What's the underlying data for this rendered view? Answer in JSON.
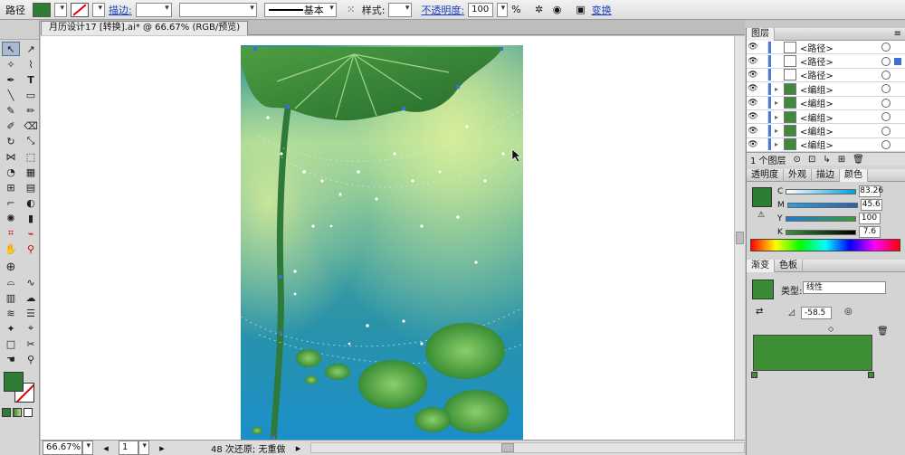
{
  "control_bar": {
    "object_type": "路径",
    "stroke_label": "描边:",
    "stroke_style": "基本",
    "style_label": "样式:",
    "opacity_label": "不透明度:",
    "opacity_value": "100",
    "opacity_unit": "%",
    "transform_label": "变换",
    "fill_color": "#2f7d34"
  },
  "document": {
    "tab_title": "月历设计17 [转换].ai* @ 66.67% (RGB/预览)"
  },
  "status_bar": {
    "zoom": "66.67%",
    "artboard": "1",
    "info": "48 次还原; 无重做"
  },
  "layers_panel": {
    "title": "图层",
    "rows": [
      {
        "name": "<路径>",
        "type": "path"
      },
      {
        "name": "<路径>",
        "type": "path"
      },
      {
        "name": "<路径>",
        "type": "path"
      },
      {
        "name": "<编组>",
        "type": "group"
      },
      {
        "name": "<编组>",
        "type": "group"
      },
      {
        "name": "<编组>",
        "type": "group"
      },
      {
        "name": "<编组>",
        "type": "group"
      },
      {
        "name": "<编组>",
        "type": "group"
      }
    ],
    "footer": "1 个图层"
  },
  "color_panel": {
    "tabs": [
      "透明度",
      "外观",
      "描边",
      "颜色"
    ],
    "channels": [
      {
        "name": "C",
        "value": "83.26"
      },
      {
        "name": "M",
        "value": "45.6"
      },
      {
        "name": "Y",
        "value": "100"
      },
      {
        "name": "K",
        "value": "7.6"
      }
    ],
    "swatch": "#2f7d34"
  },
  "gradient_panel": {
    "tabs": [
      "渐变",
      "色板"
    ],
    "type_label": "类型:",
    "type_value": "线性",
    "angle": "-58.5",
    "ramp_color": "#3d8e35"
  },
  "colors": {
    "leaf_dark": "#2e7a2e",
    "leaf_light": "#5aa84a",
    "water_top": "#bfe08a",
    "water_mid": "#3a9aa0",
    "water_bottom": "#1d8fc6"
  }
}
